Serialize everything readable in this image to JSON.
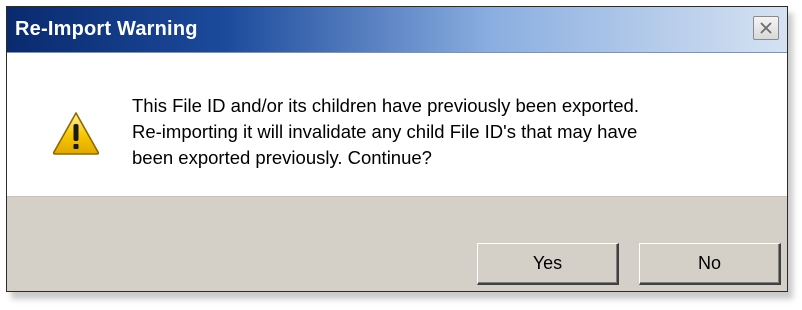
{
  "dialog": {
    "title": "Re-Import Warning",
    "close_icon": "close-icon",
    "icon": "warning-icon",
    "message_lines": [
      "This File ID and/or its children have previously been exported.",
      "Re-importing it will invalidate any child File ID's that may have",
      "been exported previously.  Continue?"
    ],
    "buttons": {
      "yes": "Yes",
      "no": "No"
    }
  },
  "colors": {
    "title_gradient_start": "#0a2a6e",
    "title_gradient_end": "#d6e2f2",
    "button_bar": "#d4d0c8",
    "warning_yellow": "#f7c600"
  }
}
